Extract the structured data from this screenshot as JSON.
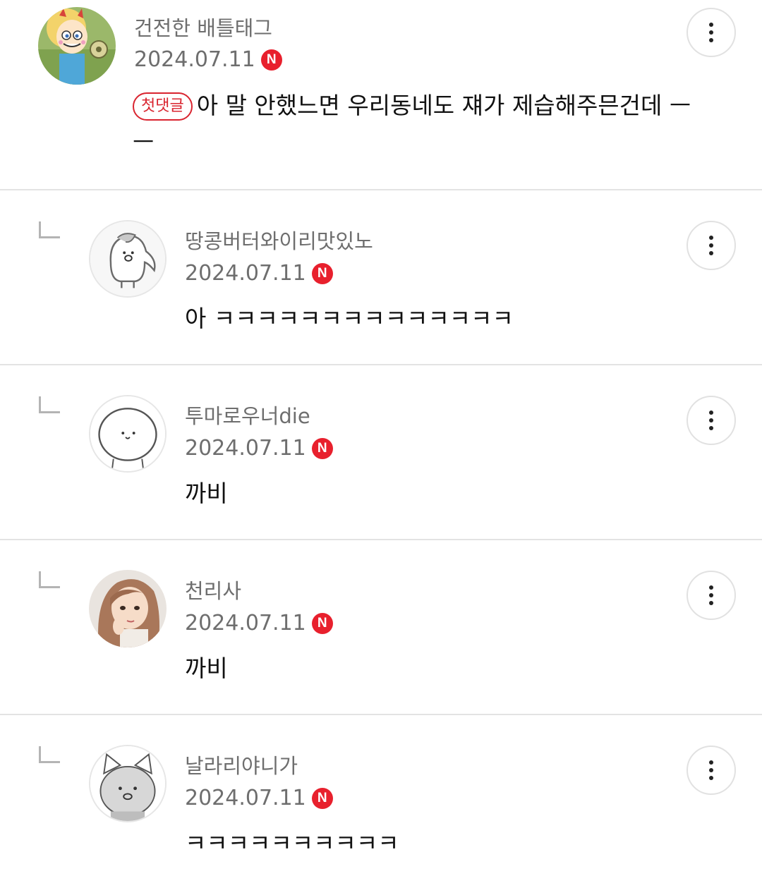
{
  "comments": [
    {
      "author": "건전한 배틀태그",
      "date": "2024.07.11",
      "badge": "N",
      "first_comment_label": "첫댓글",
      "text_line1": "아 말 안했느면 우리동네도 쟤가 제습해주믄건데 ㅡ",
      "text_line2": "ㅡ",
      "is_reply": false
    },
    {
      "author": "땅콩버터와이리맛있노",
      "date": "2024.07.11",
      "badge": "N",
      "text": "아 ㅋㅋㅋㅋㅋㅋㅋㅋㅋㅋㅋㅋㅋㅋ",
      "is_reply": true
    },
    {
      "author": "투마로우너die",
      "date": "2024.07.11",
      "badge": "N",
      "text": "까비",
      "is_reply": true
    },
    {
      "author": "천리사",
      "date": "2024.07.11",
      "badge": "N",
      "text": "까비",
      "is_reply": true
    },
    {
      "author": "날라리야니가",
      "date": "2024.07.11",
      "badge": "N",
      "text": "ㅋㅋㅋㅋㅋㅋㅋㅋㅋㅋ",
      "is_reply": true
    }
  ],
  "icons": {
    "more": "more-vertical-icon",
    "reply": "reply-arrow-icon",
    "new_badge": "naver-n-badge"
  },
  "colors": {
    "badge_red": "#e8202d",
    "first_comment_red": "#d9242f",
    "meta_gray": "#6e6e6e",
    "divider": "#e3e3e3"
  }
}
